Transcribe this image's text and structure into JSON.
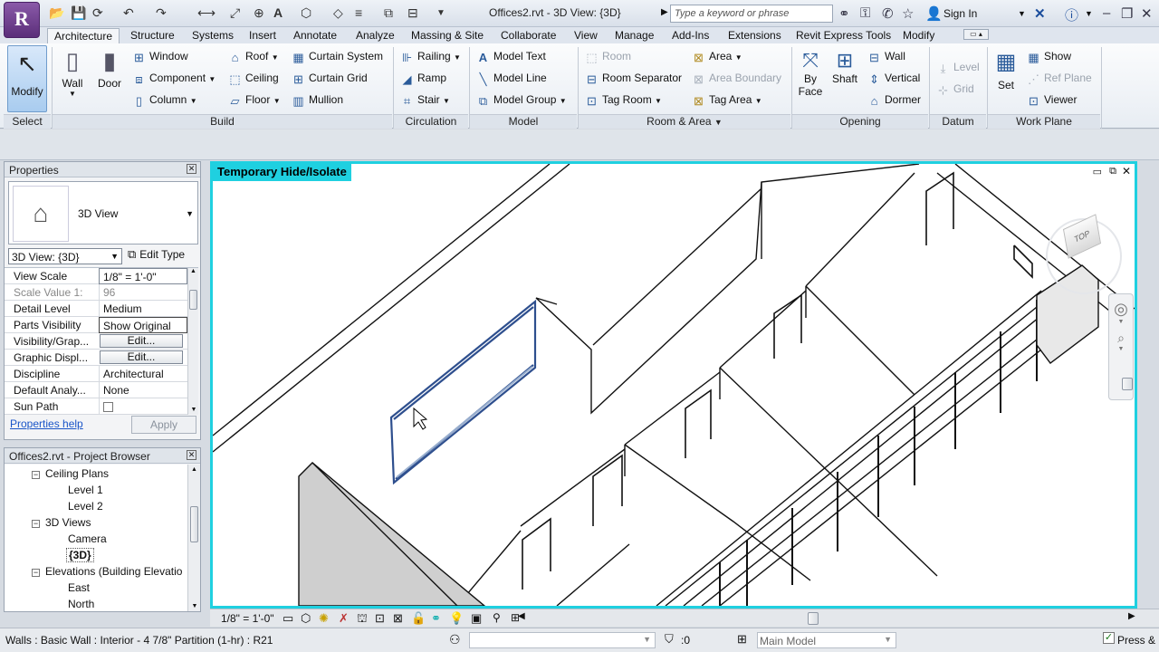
{
  "window": {
    "doc_title": "Offices2.rvt - 3D View: {3D}",
    "search_placeholder": "Type a keyword or phrase",
    "sign_in": "Sign In",
    "app_letter": "R"
  },
  "tabs": [
    "Architecture",
    "Structure",
    "Systems",
    "Insert",
    "Annotate",
    "Analyze",
    "Massing & Site",
    "Collaborate",
    "View",
    "Manage",
    "Add-Ins",
    "Extensions",
    "Revit Express Tools",
    "Modify"
  ],
  "ribbon": {
    "modify": "Modify",
    "select": "Select",
    "wall": "Wall",
    "door": "Door",
    "build": {
      "title": "Build",
      "window": "Window",
      "component": "Component",
      "column": "Column",
      "roof": "Roof",
      "ceiling": "Ceiling",
      "floor": "Floor",
      "curtain_system": "Curtain System",
      "curtain_grid": "Curtain Grid",
      "mullion": "Mullion"
    },
    "circulation": {
      "title": "Circulation",
      "railing": "Railing",
      "ramp": "Ramp",
      "stair": "Stair"
    },
    "model": {
      "title": "Model",
      "model_text": "Model Text",
      "model_line": "Model Line",
      "model_group": "Model Group"
    },
    "room_area": {
      "title": "Room & Area",
      "room": "Room",
      "room_separator": "Room Separator",
      "tag_room": "Tag Room",
      "area": "Area",
      "area_boundary": "Area Boundary",
      "tag_area": "Tag Area"
    },
    "opening": {
      "title": "Opening",
      "by_face_1": "By",
      "by_face_2": "Face",
      "shaft": "Shaft",
      "wall": "Wall",
      "vertical": "Vertical",
      "dormer": "Dormer"
    },
    "datum": {
      "title": "Datum",
      "level": "Level",
      "grid": "Grid"
    },
    "work_plane": {
      "title": "Work Plane",
      "set": "Set",
      "show": "Show",
      "ref_plane": "Ref Plane",
      "viewer": "Viewer"
    }
  },
  "properties": {
    "title": "Properties",
    "type_name": "3D View",
    "instance_selector": "3D View: {3D}",
    "edit_type": "Edit Type",
    "rows": [
      {
        "key": "View Scale",
        "value": "1/8\" = 1'-0\""
      },
      {
        "key": "Scale Value    1:",
        "value": "96"
      },
      {
        "key": "Detail Level",
        "value": "Medium"
      },
      {
        "key": "Parts Visibility",
        "value": "Show Original"
      },
      {
        "key": "Visibility/Grap...",
        "value": "Edit..."
      },
      {
        "key": "Graphic Displ...",
        "value": "Edit..."
      },
      {
        "key": "Discipline",
        "value": "Architectural"
      },
      {
        "key": "Default Analy...",
        "value": "None"
      },
      {
        "key": "Sun Path",
        "value": ""
      }
    ],
    "help_link": "Properties help",
    "apply": "Apply"
  },
  "browser": {
    "title": "Offices2.rvt - Project Browser",
    "items": [
      {
        "label": "Ceiling Plans",
        "level": 1,
        "box": "−"
      },
      {
        "label": "Level 1",
        "level": 2
      },
      {
        "label": "Level 2",
        "level": 2
      },
      {
        "label": "3D Views",
        "level": 1,
        "box": "−"
      },
      {
        "label": "Camera",
        "level": 2
      },
      {
        "label": "{3D}",
        "level": 2
      },
      {
        "label": "Elevations (Building Elevatio",
        "level": 1,
        "box": "−"
      },
      {
        "label": "East",
        "level": 2
      },
      {
        "label": "North",
        "level": 2
      }
    ]
  },
  "viewport": {
    "mode_label": "Temporary Hide/Isolate",
    "viewcube_label": "TOP"
  },
  "viewbar": {
    "scale": "1/8\" = 1'-0\""
  },
  "status": {
    "message": "Walls : Basic Wall : Interior - 4 7/8\" Partition (1-hr) : R21",
    "selection_count": ":0",
    "model": "Main Model",
    "press_drag": "Press &"
  }
}
